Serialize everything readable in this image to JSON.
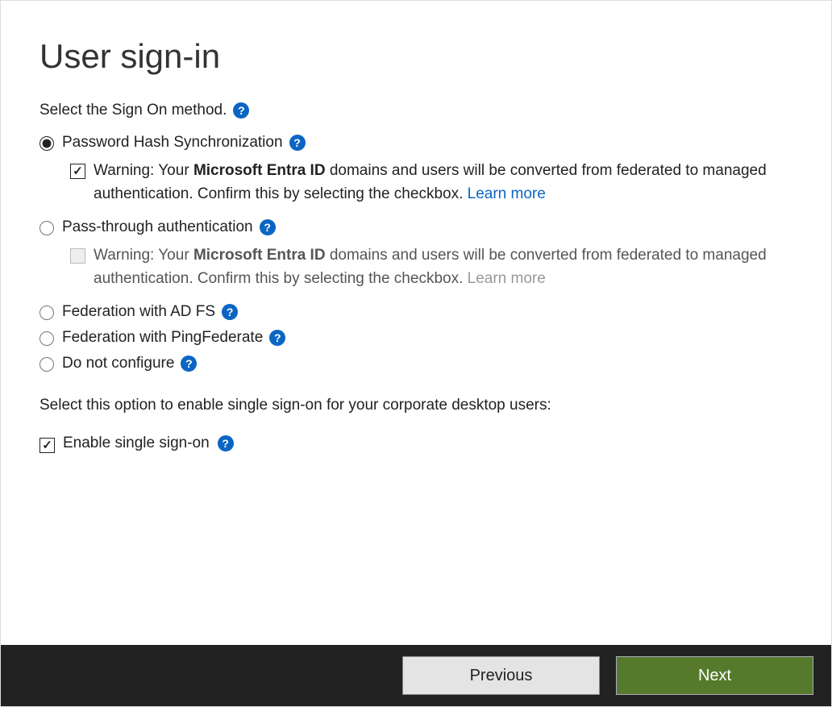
{
  "header": {
    "title": "User sign-in"
  },
  "sign_on": {
    "label": "Select the Sign On method.",
    "options": {
      "phs": {
        "label": "Password Hash Synchronization",
        "selected": true,
        "warning_prefix": "Warning: Your ",
        "warning_bold": "Microsoft Entra ID",
        "warning_suffix": " domains and users will be converted from federated to managed authentication. Confirm this by selecting the checkbox. ",
        "learn_more": "Learn more",
        "checked": true
      },
      "pta": {
        "label": "Pass-through authentication",
        "selected": false,
        "warning_prefix": "Warning: Your ",
        "warning_bold": "Microsoft Entra ID",
        "warning_suffix": " domains and users will be converted from federated to managed authentication. Confirm this by selecting the checkbox. ",
        "learn_more": "Learn more",
        "checked": false
      },
      "adfs": {
        "label": "Federation with AD FS",
        "selected": false
      },
      "ping": {
        "label": "Federation with PingFederate",
        "selected": false
      },
      "none": {
        "label": "Do not configure",
        "selected": false
      }
    }
  },
  "sso": {
    "label": "Select this option to enable single sign-on for your corporate desktop users:",
    "checkbox_label": "Enable single sign-on",
    "checked": true
  },
  "footer": {
    "previous": "Previous",
    "next": "Next"
  }
}
